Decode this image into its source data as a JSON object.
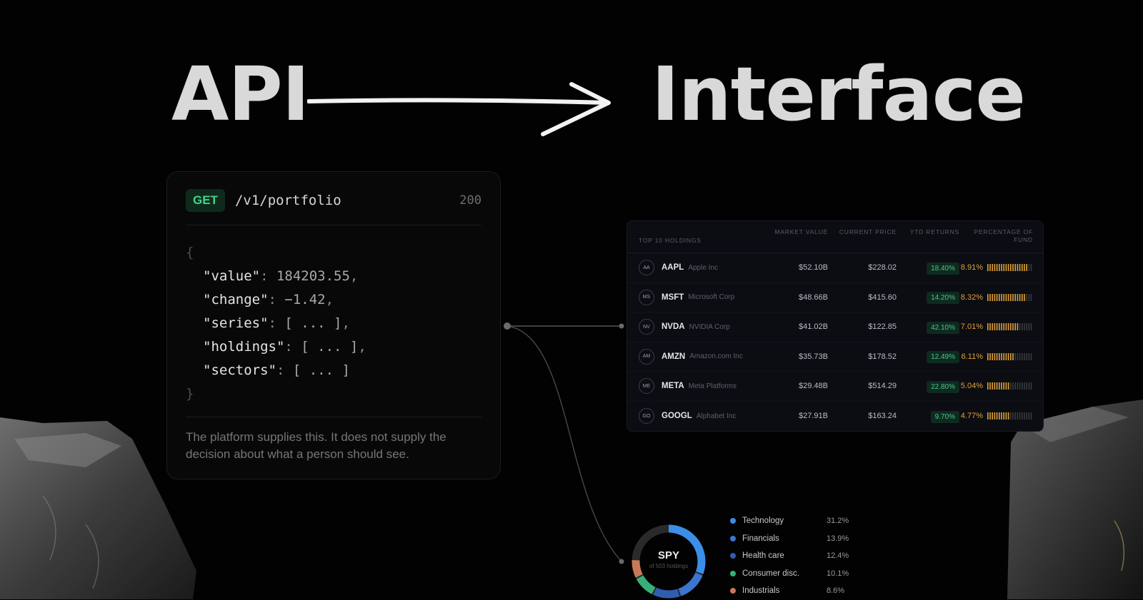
{
  "headline": {
    "left": "API",
    "right": "Interface"
  },
  "api": {
    "method": "GET",
    "path": "/v1/portfolio",
    "status": "200",
    "open_brace": "{",
    "close_brace": "}",
    "fields": [
      {
        "key": "\"value\"",
        "sep": ": ",
        "value": "184203.55",
        "tail": ","
      },
      {
        "key": "\"change\"",
        "sep": ": ",
        "value": "−1.42",
        "tail": ","
      },
      {
        "key": "\"series\"",
        "sep": ": ",
        "value": "[ ... ]",
        "tail": ","
      },
      {
        "key": "\"holdings\"",
        "sep": ": ",
        "value": "[ ... ]",
        "tail": ","
      },
      {
        "key": "\"sectors\"",
        "sep": ": ",
        "value": "[ ... ]",
        "tail": ""
      }
    ],
    "footnote": "The platform supplies this. It does not supply the decision about what a person should see."
  },
  "holdings": {
    "headers": {
      "name": "TOP 10 HOLDINGS",
      "market_value": "MARKET VALUE",
      "current_price": "CURRENT PRICE",
      "ytd": "YTD RETURNS",
      "pct": "PERCENTAGE OF FUND"
    },
    "rows": [
      {
        "initials": "AA",
        "ticker": "AAPL",
        "company": "Apple Inc",
        "market_value": "$52.10B",
        "price": "$228.02",
        "ytd": "18.40%",
        "pct": "8.91%",
        "fill": 0.89
      },
      {
        "initials": "MS",
        "ticker": "MSFT",
        "company": "Microsoft Corp",
        "market_value": "$48.66B",
        "price": "$415.60",
        "ytd": "14.20%",
        "pct": "8.32%",
        "fill": 0.83
      },
      {
        "initials": "NV",
        "ticker": "NVDA",
        "company": "NVIDIA Corp",
        "market_value": "$41.02B",
        "price": "$122.85",
        "ytd": "42.10%",
        "pct": "7.01%",
        "fill": 0.7
      },
      {
        "initials": "AM",
        "ticker": "AMZN",
        "company": "Amazon.com Inc",
        "market_value": "$35.73B",
        "price": "$178.52",
        "ytd": "12.49%",
        "pct": "6.11%",
        "fill": 0.61
      },
      {
        "initials": "ME",
        "ticker": "META",
        "company": "Meta Platforms",
        "market_value": "$29.48B",
        "price": "$514.29",
        "ytd": "22.80%",
        "pct": "5.04%",
        "fill": 0.5
      },
      {
        "initials": "GO",
        "ticker": "GOOGL",
        "company": "Alphabet Inc",
        "market_value": "$27.91B",
        "price": "$163.24",
        "ytd": "9.70%",
        "pct": "4.77%",
        "fill": 0.48
      }
    ]
  },
  "spy": {
    "title": "SPY",
    "subtitle": "of 503 holdings",
    "sectors": [
      {
        "name": "Technology",
        "value": "31.2%",
        "share": 31.2,
        "color": "#3b8fe8"
      },
      {
        "name": "Financials",
        "value": "13.9%",
        "share": 13.9,
        "color": "#3a76cf"
      },
      {
        "name": "Health care",
        "value": "12.4%",
        "share": 12.4,
        "color": "#2e5fae"
      },
      {
        "name": "Consumer disc.",
        "value": "10.1%",
        "share": 10.1,
        "color": "#36b07a"
      },
      {
        "name": "Industrials",
        "value": "8.6%",
        "share": 8.6,
        "color": "#c9785a"
      }
    ],
    "rest_color": "#2a2a2a"
  },
  "colors": {
    "accent_green": "#43d489",
    "pct_orange": "#e0a23c"
  }
}
